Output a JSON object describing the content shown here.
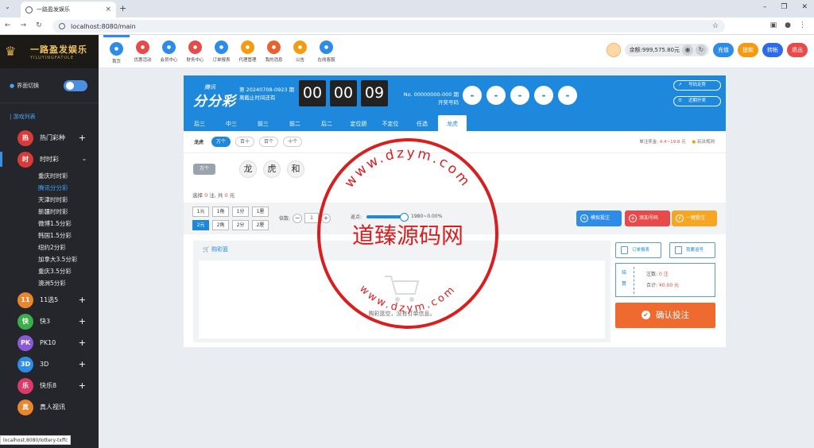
{
  "browser": {
    "tab_title": "一路盈发娱乐",
    "url": "localhost:8080/main",
    "status_url": "localhost:8080/lottery-txffc"
  },
  "header": {
    "logo_name": "一路盈发娱乐",
    "logo_sub": "YILUYINGFATULE",
    "nav": [
      {
        "label": "首页",
        "icon": "home-icon",
        "color": "#2d8ce8"
      },
      {
        "label": "优惠活动",
        "icon": "gift-icon",
        "color": "#e84a4a"
      },
      {
        "label": "会员中心",
        "icon": "user-icon",
        "color": "#2d8ce8"
      },
      {
        "label": "财务中心",
        "icon": "money-icon",
        "color": "#e84a4a"
      },
      {
        "label": "订单报表",
        "icon": "report-icon",
        "color": "#2d8ce8"
      },
      {
        "label": "代理管理",
        "icon": "agent-icon",
        "color": "#f39c12"
      },
      {
        "label": "我的消息",
        "icon": "message-icon",
        "color": "#e8622d"
      },
      {
        "label": "公告",
        "icon": "bell-icon",
        "color": "#f39c12"
      },
      {
        "label": "在线客服",
        "icon": "headset-icon",
        "color": "#2d8ce8"
      }
    ],
    "balance": "余额:999,575.80元",
    "buttons": {
      "recharge": "充值",
      "withdraw": "提款",
      "transfer": "转帐",
      "logout": "退出"
    }
  },
  "sidebar": {
    "toggle_label": "界面切换",
    "section_title": "游戏列表",
    "categories": [
      {
        "label": "热门彩种",
        "icon_text": "热",
        "color": "#d93a3a",
        "state": "+"
      },
      {
        "label": "时时彩",
        "icon_text": "时",
        "color": "#d93a3a",
        "state": "-"
      }
    ],
    "subitems": [
      "重庆时时彩",
      "腾讯分分彩",
      "天津时时彩",
      "新疆时时彩",
      "微博1.5分彩",
      "韩国1.5分彩",
      "纽约2分彩",
      "加拿大3.5分彩",
      "重庆3.5分彩",
      "澳洲5分彩"
    ],
    "active_sub": 1,
    "categories2": [
      {
        "label": "11选5",
        "icon_text": "11",
        "color": "#e8862d",
        "state": "+"
      },
      {
        "label": "快3",
        "icon_text": "快",
        "color": "#3aae4a",
        "state": "+"
      },
      {
        "label": "PK10",
        "icon_text": "PK",
        "color": "#8a5ad6",
        "state": "+"
      },
      {
        "label": "3D",
        "icon_text": "3D",
        "color": "#2d8ce8",
        "state": "+"
      },
      {
        "label": "快乐8",
        "icon_text": "乐",
        "color": "#d93a6a",
        "state": "+"
      },
      {
        "label": "真人视讯",
        "icon_text": "真",
        "color": "#e8862d",
        "state": ""
      }
    ]
  },
  "lottery": {
    "brand_top": "腾讯",
    "brand_main": "分分彩",
    "issue": "第 20240708-0923 期",
    "issue_sub": "离截止时间还有",
    "countdown": [
      "00",
      "00",
      "09"
    ],
    "draw_no": "No. 00000000-000 期",
    "draw_sub": "开奖号码",
    "balls": [
      "-",
      "-",
      "-",
      "-",
      "-"
    ],
    "side_buttons": [
      "号码走势",
      "近期开奖"
    ],
    "tabs": [
      "后三",
      "中三",
      "前三",
      "前二",
      "后二",
      "定位胆",
      "不定位",
      "任选",
      "龙虎"
    ],
    "active_tab": 8,
    "subtab_label": "龙虎",
    "subtabs": [
      "万个",
      "百十",
      "百个",
      "十个"
    ],
    "prize_label": "单注奖金:",
    "prize_value": "4.4~19.8",
    "prize_unit": "元",
    "rules": "玩法规则",
    "pick_tag": "万个",
    "pick_balls": [
      "龙",
      "虎",
      "和"
    ],
    "sel_prefix": "选择",
    "sel_count": "0",
    "sel_mid": "注, 共",
    "sel_amount": "0",
    "sel_unit": "元",
    "units_row1": [
      "1元",
      "1角",
      "1分",
      "1厘"
    ],
    "units_row2": [
      "2元",
      "2角",
      "2分",
      "2厘"
    ],
    "multiple_label": "倍数:",
    "multiple_value": "1",
    "rebate_label": "返点:",
    "rebate_value": "1980~0.00%",
    "actions": [
      {
        "label": "模拟投注",
        "color": "#2d8ce8",
        "icon": "+"
      },
      {
        "label": "添加号码",
        "color": "#e84a4a",
        "icon": "+"
      },
      {
        "label": "一键投注",
        "color": "#f5a623",
        "icon": "⚡"
      }
    ],
    "cart_title": "购彩篮",
    "cart_empty": "购彩篮空，没有订单信息。",
    "order_report": "订单报表",
    "my_tracking": "我要追号",
    "summary_side": "结算",
    "count_label": "注数:",
    "count_value": "0 注",
    "total_label": "合计:",
    "total_value": "¥0.00 元",
    "confirm": "确认投注"
  },
  "watermark": {
    "center": "道臻源码网",
    "top": "www.dzym.com",
    "bottom": "www.dzym.com"
  }
}
